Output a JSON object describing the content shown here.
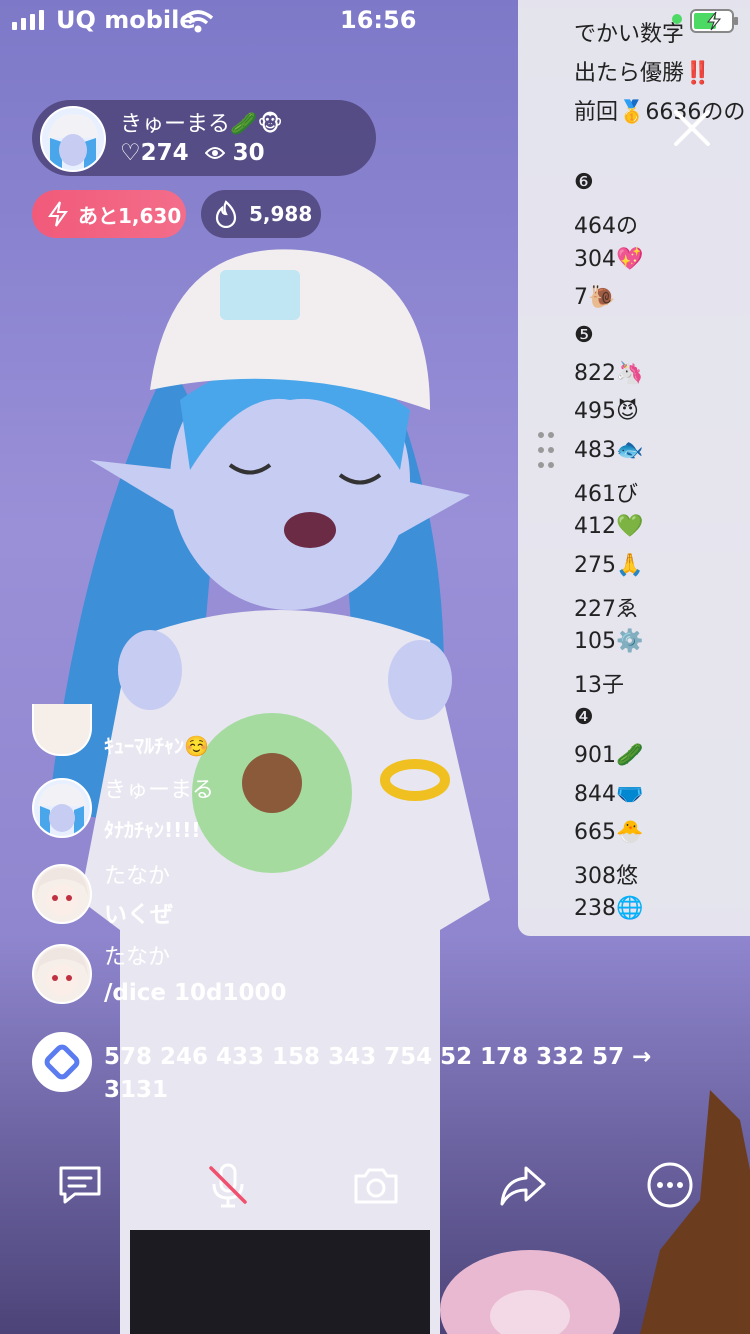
{
  "status_bar": {
    "carrier": "UQ mobile",
    "time": "16:56",
    "wifi_icon": "wifi-icon",
    "battery_icon": "battery-charging-icon"
  },
  "host": {
    "name": "きゅーまる🥒🐵",
    "likes": "♡274",
    "viewers": "30",
    "viewers_icon": "eye-icon"
  },
  "badges": {
    "goal": "あと1,630",
    "goal_icon": "lightning-icon",
    "fire": "5,988",
    "fire_icon": "flame-icon"
  },
  "side_panel": {
    "lines": [
      "でかい数字",
      "出たら優勝‼️",
      "前回🥇6636のの",
      "",
      "❻",
      "464の",
      "304💖",
      "7🐌",
      "❺",
      "822🦄",
      "495😈",
      "483🐟",
      "461び",
      "412💚",
      "275🙏",
      "227ゑ",
      "105⚙️",
      "13子",
      "❹",
      "901🥒",
      "844🩲",
      "665🐣",
      "308悠",
      "238🌐"
    ]
  },
  "chat": [
    {
      "name": "",
      "message": "ｷｭｰﾏﾙﾁｬﾝ☺️"
    },
    {
      "name": "きゅーまる",
      "message": "ﾀﾅｶﾁｬﾝ!!!!"
    },
    {
      "name": "たなか",
      "message": "いくぜ"
    },
    {
      "name": "たなか",
      "message": "/dice 10d1000"
    },
    {
      "name": "",
      "message": "578 246 433 158 343 754 52 178 332 57 →",
      "message2": "3131"
    }
  ],
  "toolbar": [
    "comment-icon",
    "mic-muted-icon",
    "camera-icon",
    "share-icon",
    "more-icon"
  ],
  "colors": {
    "accent_pink": "#f25a7a",
    "panel_bg": "#ececf0"
  }
}
